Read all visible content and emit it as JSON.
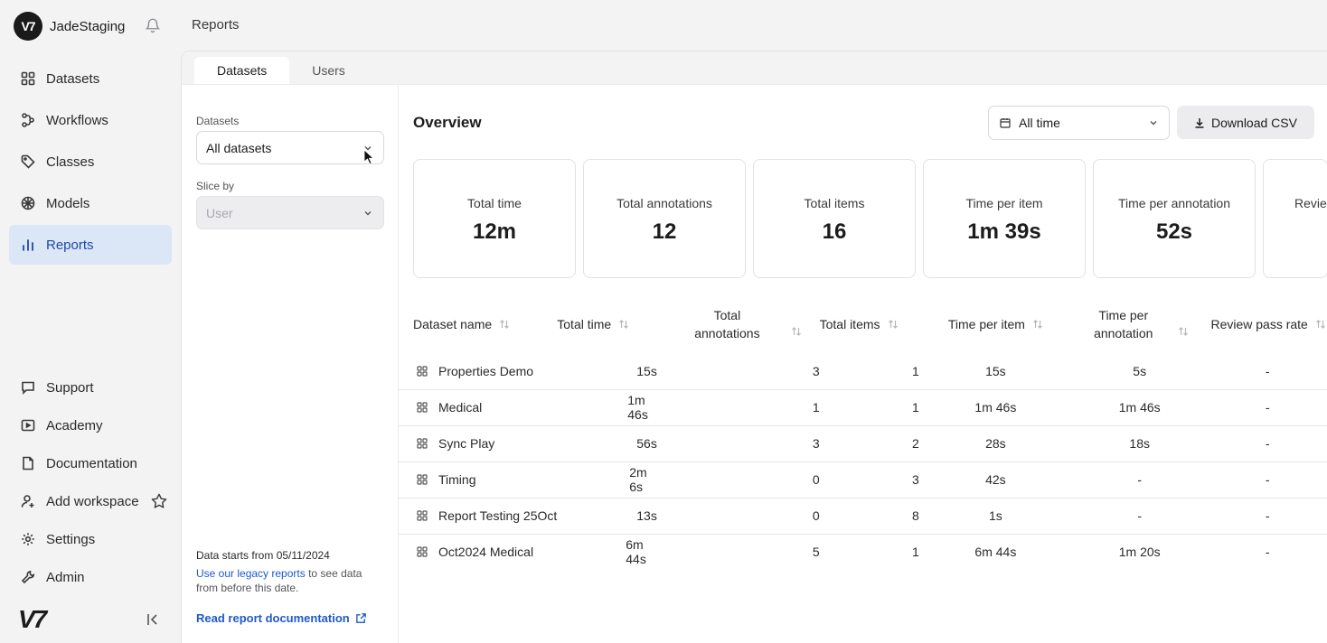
{
  "workspace": {
    "logo_text": "V7",
    "name": "JadeStaging"
  },
  "breadcrumb": "Reports",
  "sidebar": {
    "top_items": [
      {
        "label": "Datasets",
        "icon": "grid-icon"
      },
      {
        "label": "Workflows",
        "icon": "workflow-icon"
      },
      {
        "label": "Classes",
        "icon": "tag-icon"
      },
      {
        "label": "Models",
        "icon": "brain-icon"
      },
      {
        "label": "Reports",
        "icon": "bar-chart-icon",
        "active": true
      }
    ],
    "bottom_items": [
      {
        "label": "Support",
        "icon": "chat-icon"
      },
      {
        "label": "Academy",
        "icon": "play-icon"
      },
      {
        "label": "Documentation",
        "icon": "document-icon"
      },
      {
        "label": "Add workspace",
        "icon": "add-user-icon"
      },
      {
        "label": "Settings",
        "icon": "gear-icon"
      },
      {
        "label": "Admin",
        "icon": "wrench-icon"
      }
    ],
    "footer_logo": "V7"
  },
  "tabs": [
    {
      "label": "Datasets",
      "active": true
    },
    {
      "label": "Users",
      "active": false
    }
  ],
  "filters": {
    "datasets_label": "Datasets",
    "datasets_value": "All datasets",
    "slice_label": "Slice by",
    "slice_value": "User",
    "note_start": "Data starts from 05/11/2024",
    "note_link": "Use our legacy reports",
    "note_rest": " to see data from before this date.",
    "doc_link": "Read report documentation"
  },
  "overview": {
    "title": "Overview",
    "time_range": "All time",
    "download_label": "Download CSV",
    "cards": [
      {
        "title": "Total time",
        "value": "12m"
      },
      {
        "title": "Total annotations",
        "value": "12"
      },
      {
        "title": "Total items",
        "value": "16"
      },
      {
        "title": "Time per item",
        "value": "1m 39s"
      },
      {
        "title": "Time per annotation",
        "value": "52s"
      },
      {
        "title": "Revie",
        "value": ""
      }
    ]
  },
  "table": {
    "headers": [
      "Dataset name",
      "Total time",
      "Total\nannotations",
      "Total items",
      "Time per item",
      "Time per\nannotation",
      "Review pass rate"
    ],
    "rows": [
      [
        "Properties Demo",
        "15s",
        "3",
        "1",
        "15s",
        "5s",
        "-"
      ],
      [
        "Medical",
        "1m 46s",
        "1",
        "1",
        "1m 46s",
        "1m 46s",
        "-"
      ],
      [
        "Sync Play",
        "56s",
        "3",
        "2",
        "28s",
        "18s",
        "-"
      ],
      [
        "Timing",
        "2m 6s",
        "0",
        "3",
        "42s",
        "-",
        "-"
      ],
      [
        "Report Testing 25Oct",
        "13s",
        "0",
        "8",
        "1s",
        "-",
        "-"
      ],
      [
        "Oct2024 Medical",
        "6m 44s",
        "5",
        "1",
        "6m 44s",
        "1m 20s",
        "-"
      ]
    ]
  }
}
